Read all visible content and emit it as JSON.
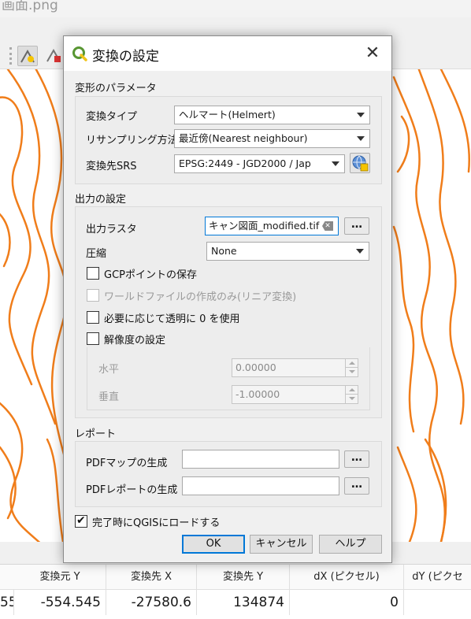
{
  "background": {
    "title_fragment": "画面.png"
  },
  "dialog": {
    "title": "変換の設定",
    "transform_section": {
      "title": "変形のパラメータ",
      "transform_type_label": "変換タイプ",
      "transform_type_value": "ヘルマート(Helmert)",
      "resampling_label": "リサンプリング方法",
      "resampling_value": "最近傍(Nearest neighbour)",
      "target_srs_label": "変換先SRS",
      "target_srs_value": "EPSG:2449 - JGD2000 / Jap"
    },
    "output_section": {
      "title": "出力の設定",
      "output_raster_label": "出力ラスタ",
      "output_raster_value": "キャン図面_modified.tif",
      "compression_label": "圧縮",
      "compression_value": "None",
      "save_gcp_label": "GCPポイントの保存",
      "save_gcp_checked": false,
      "world_file_label": "ワールドファイルの作成のみ(リニア変換)",
      "world_file_checked": false,
      "transparency_label": "必要に応じて透明に 0 を使用",
      "transparency_checked": false,
      "resolution_label": "解像度の設定",
      "resolution_checked": false,
      "horizontal_label": "水平",
      "horizontal_value": "0.00000",
      "vertical_label": "垂直",
      "vertical_value": "-1.00000"
    },
    "report_section": {
      "title": "レポート",
      "pdf_map_label": "PDFマップの生成",
      "pdf_map_value": "",
      "pdf_report_label": "PDFレポートの生成",
      "pdf_report_value": ""
    },
    "load_in_qgis_label": "完了時にQGISにロードする",
    "load_in_qgis_checked": true,
    "buttons": {
      "ok": "OK",
      "cancel": "キャンセル",
      "help": "ヘルプ"
    },
    "browse_label": "…"
  },
  "gcp_table": {
    "headers": [
      "変換元 Y",
      "変換先 X",
      "変換先 Y",
      "dX (ピクセル)",
      "dY (ピクセ"
    ],
    "row": [
      "55",
      "-554.545",
      "-27580.6",
      "134874",
      "0"
    ]
  },
  "colors": {
    "contour": "#f07d1a",
    "accent": "#0078d7",
    "qgis_green": "#589632"
  }
}
